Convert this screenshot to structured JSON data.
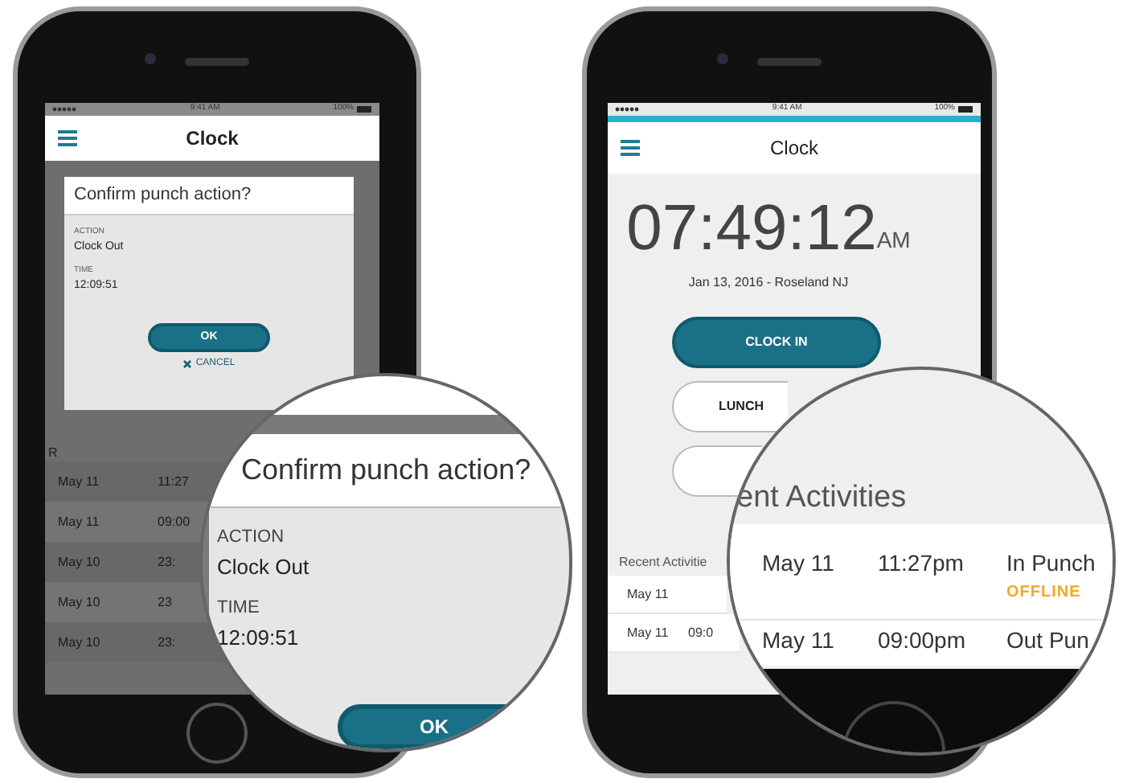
{
  "left_phone": {
    "status_bar": {
      "time": "9:41 AM",
      "battery": "100%"
    },
    "header": {
      "title": "Clock"
    },
    "background_list": {
      "heading": "R",
      "rows": [
        {
          "date": "May 11",
          "time": "11:27"
        },
        {
          "date": "May 11",
          "time": "09:00"
        },
        {
          "date": "May 10",
          "time": "23:"
        },
        {
          "date": "May 10",
          "time": "23"
        },
        {
          "date": "May 10",
          "time": "23:"
        }
      ]
    },
    "dialog": {
      "title": "Confirm punch action?",
      "fields": [
        {
          "label": "ACTION",
          "value": "Clock Out"
        },
        {
          "label": "TIME",
          "value": "12:09:51"
        }
      ],
      "ok": "OK",
      "cancel": "CANCEL"
    }
  },
  "left_magnifier": {
    "title": "Confirm punch action?",
    "fields": [
      {
        "label": "ACTION",
        "value": "Clock Out"
      },
      {
        "label": "TIME",
        "value": "12:09:51"
      }
    ],
    "ok": "OK"
  },
  "right_phone": {
    "status_bar": {
      "time": "9:41 AM",
      "battery": "100%"
    },
    "header": {
      "title": "Clock"
    },
    "clock": {
      "time": "07:49:12",
      "period": "AM"
    },
    "date_location": "Jan 13, 2016 - Roseland NJ",
    "buttons": [
      {
        "kind": "primary",
        "label": "CLOCK IN"
      },
      {
        "kind": "outline",
        "label": "LUNCH"
      },
      {
        "kind": "outline"
      }
    ],
    "recent": {
      "heading": "Recent Activitie",
      "rows": [
        {
          "date": "May 11"
        },
        {
          "date": "May 11",
          "time": "09:0"
        }
      ]
    }
  },
  "right_magnifier": {
    "heading": "ent Activities",
    "rows": [
      {
        "date": "May 11",
        "time": "11:27pm",
        "type": "In Punch",
        "status": "OFFLINE"
      },
      {
        "date": "May 11",
        "time": "09:00pm",
        "type": "Out Pun"
      }
    ]
  }
}
